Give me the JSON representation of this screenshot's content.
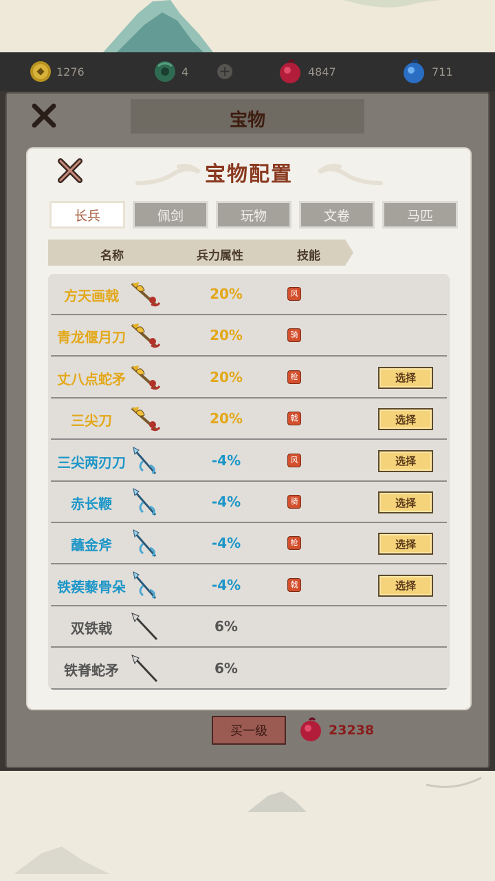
{
  "resources": [
    {
      "icon": "coin-icon",
      "value": "1276"
    },
    {
      "icon": "jade-dragon-icon",
      "value": "4"
    },
    {
      "icon": "red-gourd-icon",
      "value": "4847"
    },
    {
      "icon": "blue-gourd-icon",
      "value": "711"
    }
  ],
  "outer_panel": {
    "title": "宝物"
  },
  "dialog": {
    "title": "宝物配置",
    "tabs": [
      "长兵",
      "佩剑",
      "玩物",
      "文卷",
      "马匹"
    ],
    "active_tab": 0,
    "headers": {
      "name": "名称",
      "attr": "兵力属性",
      "skill": "技能"
    },
    "select_label": "选择",
    "items": [
      {
        "name": "方天画戟",
        "value": "20%",
        "tier": "gold",
        "weapon": "ornate-halberd-icon",
        "skill": "风",
        "selectable": false
      },
      {
        "name": "青龙偃月刀",
        "value": "20%",
        "tier": "gold",
        "weapon": "ornate-halberd-icon",
        "skill": "骑",
        "selectable": false
      },
      {
        "name": "丈八点蛇矛",
        "value": "20%",
        "tier": "gold",
        "weapon": "ornate-halberd-icon",
        "skill": "枪",
        "selectable": true
      },
      {
        "name": "三尖刀",
        "value": "20%",
        "tier": "gold",
        "weapon": "ornate-halberd-icon",
        "skill": "戟",
        "selectable": true
      },
      {
        "name": "三尖两刃刀",
        "value": "-4%",
        "tier": "blue",
        "weapon": "trident-icon",
        "skill": "风",
        "selectable": true
      },
      {
        "name": "赤长鞭",
        "value": "-4%",
        "tier": "blue",
        "weapon": "trident-icon",
        "skill": "骑",
        "selectable": true
      },
      {
        "name": "蘸金斧",
        "value": "-4%",
        "tier": "blue",
        "weapon": "trident-icon",
        "skill": "枪",
        "selectable": true
      },
      {
        "name": "铁蒺藜骨朵",
        "value": "-4%",
        "tier": "blue",
        "weapon": "trident-icon",
        "skill": "戟",
        "selectable": true
      },
      {
        "name": "双铁戟",
        "value": "6%",
        "tier": "gray",
        "weapon": "spear-icon",
        "skill": "",
        "selectable": false
      },
      {
        "name": "铁脊蛇矛",
        "value": "6%",
        "tier": "gray",
        "weapon": "spear-icon",
        "skill": "",
        "selectable": false
      }
    ]
  },
  "bottom": {
    "buy_label": "买一级",
    "cost": "23238",
    "cost_icon": "red-gourd-icon"
  },
  "colors": {
    "gold": "#e3a81a",
    "blue": "#1d96c8",
    "gray": "#555555",
    "skill": "#d3502e",
    "select_button": "#f5d37a"
  }
}
